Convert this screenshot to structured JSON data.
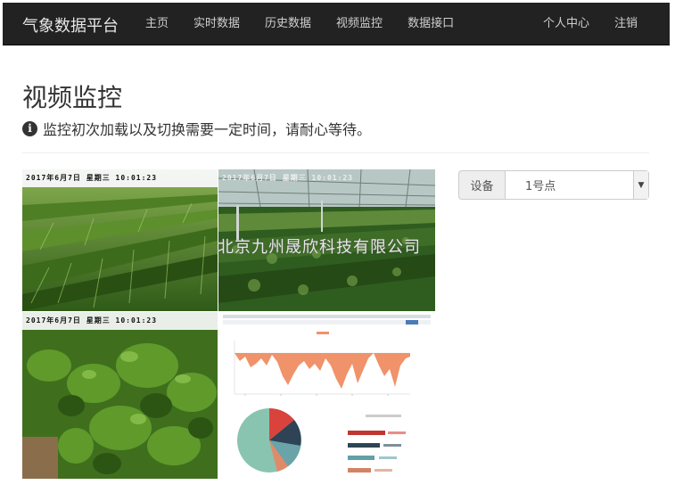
{
  "navbar": {
    "brand": "气象数据平台",
    "items": [
      {
        "label": "主页"
      },
      {
        "label": "实时数据"
      },
      {
        "label": "历史数据"
      },
      {
        "label": "视频监控"
      },
      {
        "label": "数据接口"
      }
    ],
    "right_items": [
      {
        "label": "个人中心"
      },
      {
        "label": "注销"
      }
    ]
  },
  "page": {
    "title": "视频监控",
    "notice_icon": "info-circle-icon",
    "notice": "监控初次加载以及切换需要一定时间，请耐心等待。"
  },
  "cameras": [
    {
      "timestamp": "2017年6月7日  星期三  10:01:23"
    },
    {
      "timestamp": "2017年6月7日  星期三  10:01:23"
    },
    {
      "timestamp": "2017年6月7日  星期三  10:01:23"
    }
  ],
  "watermark": "北京九州晟欣科技有限公司",
  "device": {
    "label": "设备",
    "selected": "1号点"
  },
  "colors": {
    "navbar_bg": "#222222",
    "nav_text": "#cfcfcf",
    "chart_fill": "#f0926a",
    "pie_teal": "#89c4b0",
    "pie_red": "#d9433b",
    "pie_navy": "#2e4356"
  }
}
